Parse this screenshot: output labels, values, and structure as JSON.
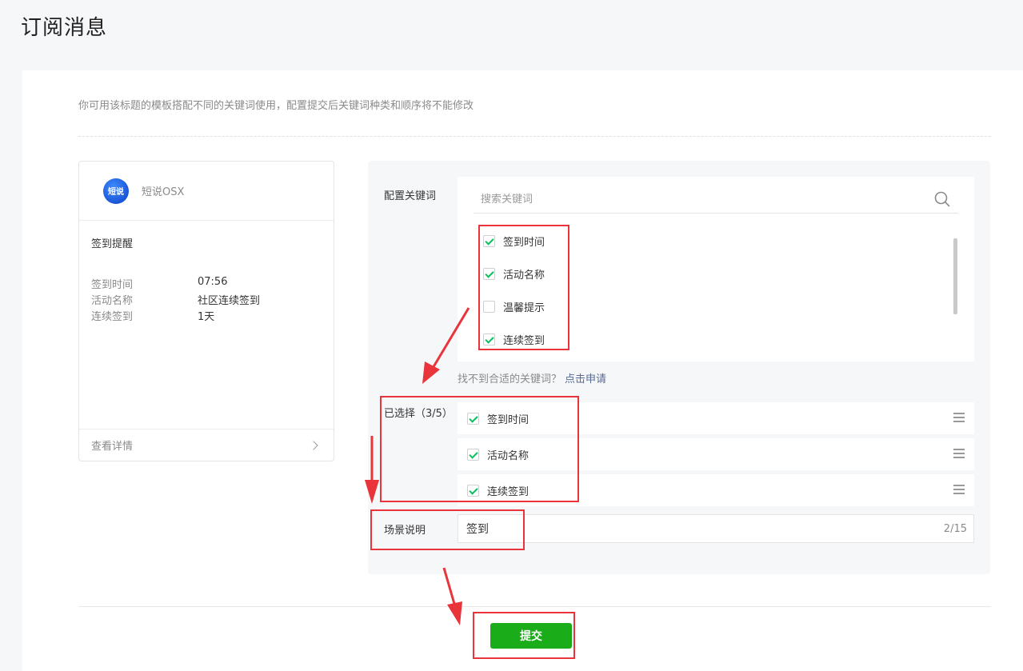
{
  "page": {
    "title": "订阅消息"
  },
  "tip": "你可用该标题的模板搭配不同的关键词使用，配置提交后关键词种类和顺序将不能修改",
  "preview": {
    "avatar_text": "短说",
    "app_name": "短说OSX",
    "message_title": "签到提醒",
    "rows": [
      {
        "label": "签到时间",
        "value": "07:56"
      },
      {
        "label": "活动名称",
        "value": "社区连续签到"
      },
      {
        "label": "连续签到",
        "value": "1天"
      }
    ],
    "footer_link": "查看详情"
  },
  "config": {
    "keywords_label": "配置关键词",
    "search_placeholder": "搜索关键词",
    "keywords": [
      {
        "label": "签到时间",
        "checked": true
      },
      {
        "label": "活动名称",
        "checked": true
      },
      {
        "label": "温馨提示",
        "checked": false
      },
      {
        "label": "连续签到",
        "checked": true
      }
    ],
    "hint_text": "找不到合适的关键词？",
    "hint_link": "点击申请",
    "selected_label": "已选择（3/5）",
    "selected": [
      {
        "label": "签到时间"
      },
      {
        "label": "活动名称"
      },
      {
        "label": "连续签到"
      }
    ],
    "scene_label": "场景说明",
    "scene_value": "签到",
    "scene_counter": "2/15"
  },
  "submit_label": "提交",
  "colors": {
    "primary": "#1aad19",
    "check": "#07c160",
    "link": "#576b95",
    "annotation": "#e8343a"
  }
}
